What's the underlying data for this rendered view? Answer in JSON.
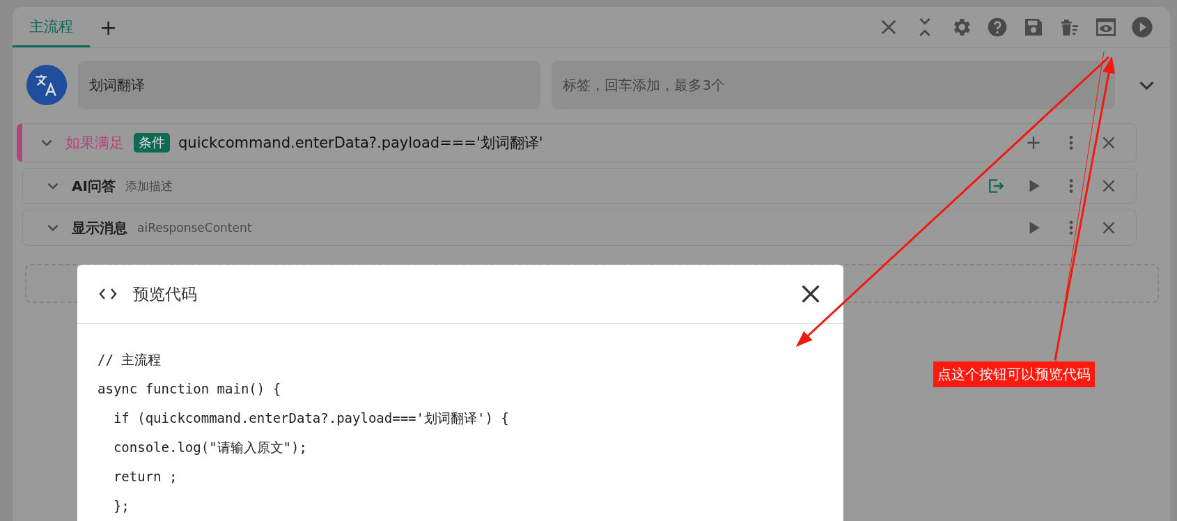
{
  "tabs": [
    {
      "label": "主流程",
      "selected": true
    }
  ],
  "add_tab": "+",
  "command": {
    "name": "划词翻译",
    "tags_placeholder": "标签，回车添加，最多3个"
  },
  "blocks": [
    {
      "kind": "condition",
      "title": "如果满足",
      "tag": "条件",
      "value": "quickcommand.enterData?.payload==='划词翻译'",
      "output_variable": false
    },
    {
      "kind": "command",
      "title": "AI问答",
      "description_placeholder": "添加描述",
      "output_variable": true
    },
    {
      "kind": "command",
      "title": "显示消息",
      "description": "aiResponseContent",
      "output_variable": false
    }
  ],
  "modal": {
    "title": "预览代码",
    "code_lines": [
      "// 主流程",
      "async function main() {",
      "  if (quickcommand.enterData?.payload==='划词翻译') {",
      "  console.log(\"请输入原文\");",
      "  return ;",
      "  };"
    ]
  },
  "annotation": {
    "text": "点这个按钮可以预览代码"
  }
}
